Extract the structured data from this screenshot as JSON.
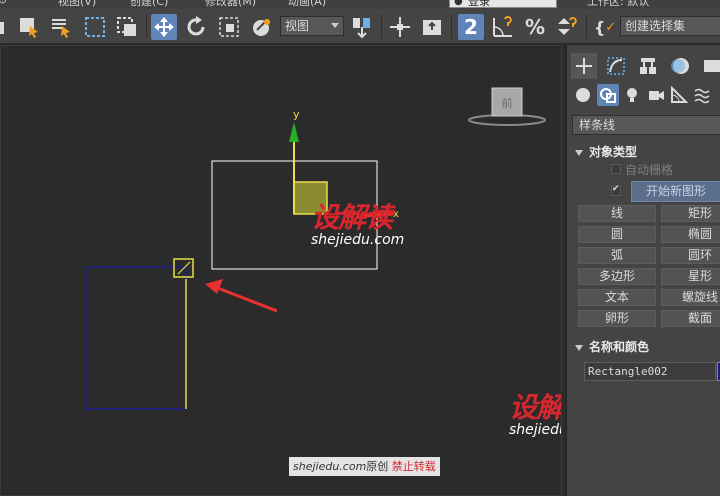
{
  "menubar": {
    "items": [
      "视图(V)",
      "创建(C)",
      "修改器(M)",
      "动画(A)"
    ],
    "login": "登录",
    "workspace": "工作区: 默认"
  },
  "toolbar": {
    "view_select": "视图",
    "snap_value": "2",
    "selection_set": "创建选择集"
  },
  "viewport": {
    "axis_y": "y",
    "axis_x": "x",
    "viewcube_label": "前",
    "watermark_logo_1": "设解读",
    "watermark_url": "shejiedu.com",
    "credit_url": "shejiedu.com",
    "credit_original": "原创",
    "credit_no_repost": "禁止转载"
  },
  "panel": {
    "category": "样条线",
    "object_type_title": "对象类型",
    "auto_grid": "自动栅格",
    "start_new_shape": "开始新图形",
    "buttons": [
      "线",
      "矩形",
      "圆",
      "椭圆",
      "弧",
      "圆环",
      "多边形",
      "星形",
      "文本",
      "螺旋线",
      "卵形",
      "截面"
    ],
    "name_color_title": "名称和颜色",
    "object_name": "Rectangle002"
  },
  "colors": {
    "accent": "#5e84b8",
    "object_color": "#1b1d8a",
    "selection_yellow": "#e8e04a"
  }
}
